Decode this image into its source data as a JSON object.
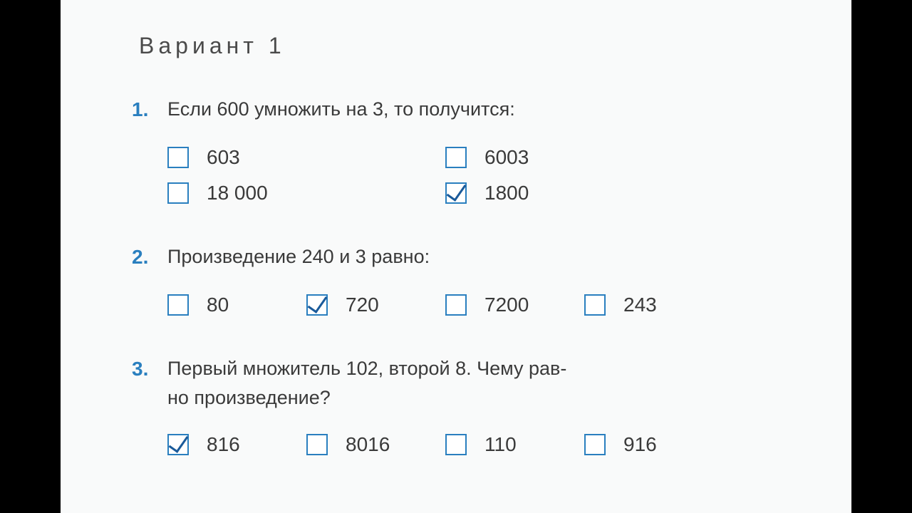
{
  "variant_title": "Вариант 1",
  "questions": [
    {
      "num": "1.",
      "text": "Если 600 умножить на 3, то получится:",
      "layout": "two-col",
      "options": [
        {
          "label": "603",
          "checked": false
        },
        {
          "label": "6003",
          "checked": false
        },
        {
          "label": "18 000",
          "checked": false
        },
        {
          "label": "1800",
          "checked": true
        }
      ]
    },
    {
      "num": "2.",
      "text": "Произведение 240 и 3 равно:",
      "layout": "four-col",
      "options": [
        {
          "label": "80",
          "checked": false
        },
        {
          "label": "720",
          "checked": true
        },
        {
          "label": "7200",
          "checked": false
        },
        {
          "label": "243",
          "checked": false
        }
      ]
    },
    {
      "num": "3.",
      "text": "Первый множитель 102, второй 8. Чему рав-\nно произведение?",
      "layout": "four-col",
      "options": [
        {
          "label": "816",
          "checked": true
        },
        {
          "label": "8016",
          "checked": false
        },
        {
          "label": "110",
          "checked": false
        },
        {
          "label": "916",
          "checked": false
        }
      ]
    }
  ]
}
